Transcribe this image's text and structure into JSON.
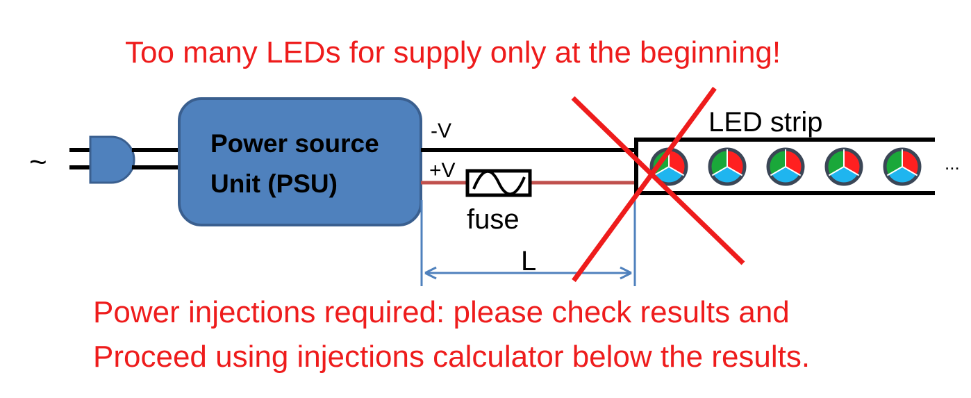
{
  "warning_title": "Too many LEDs for supply only at the beginning!",
  "psu": {
    "line1": "Power source",
    "line2": "Unit (PSU)"
  },
  "ac_symbol": "~",
  "wire_labels": {
    "negative": "-V",
    "positive": "+V"
  },
  "fuse_label": "fuse",
  "length_label": "L",
  "strip": {
    "label": "LED strip",
    "ellipsis": "...",
    "led_count": 5
  },
  "instructions": {
    "line1": "Power injections required: please check results and",
    "line2": "Proceed using injections calculator below the results."
  },
  "colors": {
    "warning_red": "#ee1c1c",
    "psu_fill": "#4f81bd",
    "psu_stroke": "#3a5f8f",
    "positive_wire": "#c0504d",
    "dimension": "#4f81bd",
    "led_red": "#ff2020",
    "led_green": "#1aa83a",
    "led_cyan": "#1fb5ef",
    "led_rim": "#3b4656"
  },
  "icons": [
    "plug-icon",
    "sine-wave-icon",
    "rgb-led-icon",
    "cross-out-icon"
  ]
}
